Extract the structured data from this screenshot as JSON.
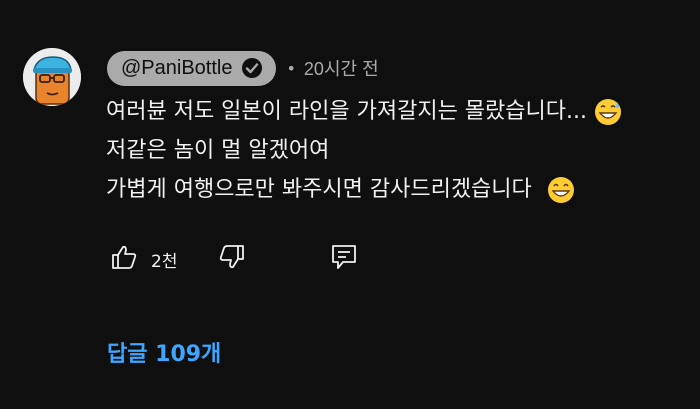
{
  "comment": {
    "author": "@PaniBottle",
    "verified_icon": "check-circle-icon",
    "separator": "•",
    "timestamp": "20시간 전",
    "lines": [
      "여러뷴 저도 일본이 라인을 가져갈지는 몰랐습니다...",
      "저같은 놈이 멀 알겠어여",
      "가볍게 여행으로만 봐주시면 감사드리겠습니다"
    ],
    "emojis": [
      "grinning-sweat-emoji",
      "grinning-emoji"
    ],
    "like_count": "2천",
    "icons": {
      "like": "thumbs-up-icon",
      "dislike": "thumbs-down-icon",
      "reply": "reply-icon"
    },
    "replies_label": "답글 109개"
  },
  "colors": {
    "background": "#0f0f0f",
    "text": "#f1f1f1",
    "muted": "#aaaaaa",
    "link": "#3ea6ff",
    "author_chip": "#aaaaaa"
  }
}
